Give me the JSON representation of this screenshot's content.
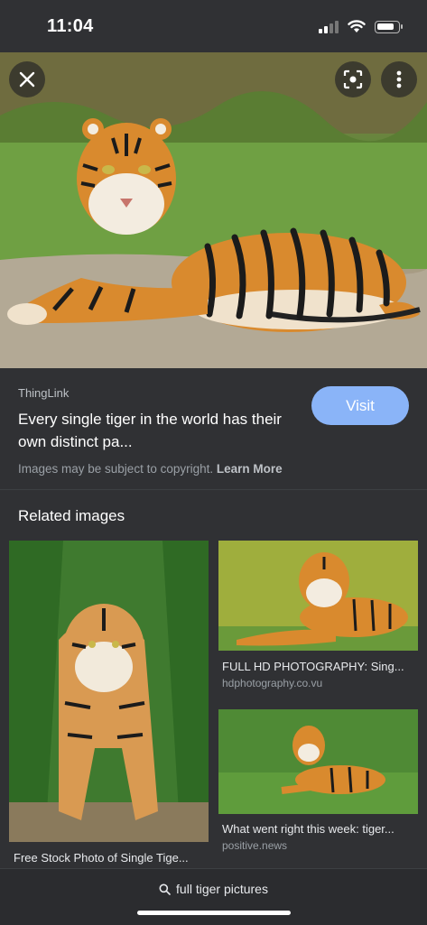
{
  "status_bar": {
    "time": "11:04"
  },
  "main_image": {
    "alt": "Tiger lying on the ground"
  },
  "info": {
    "source": "ThingLink",
    "title": "Every single tiger in the world has their own distinct pa...",
    "visit_label": "Visit",
    "copyright_text": "Images may be subject to copyright.",
    "learn_more": "Learn More"
  },
  "related": {
    "heading": "Related images",
    "items": [
      {
        "caption": "Free Stock Photo of Single Tige...",
        "domain": ""
      },
      {
        "caption": "FULL HD PHOTOGRAPHY: Sing...",
        "domain": "hdphotography.co.vu"
      },
      {
        "caption": "What went right this week: tiger...",
        "domain": "positive.news"
      }
    ]
  },
  "bottom": {
    "query": "full tiger pictures"
  },
  "colors": {
    "background": "#303134",
    "visit_button": "#8ab4f8"
  }
}
